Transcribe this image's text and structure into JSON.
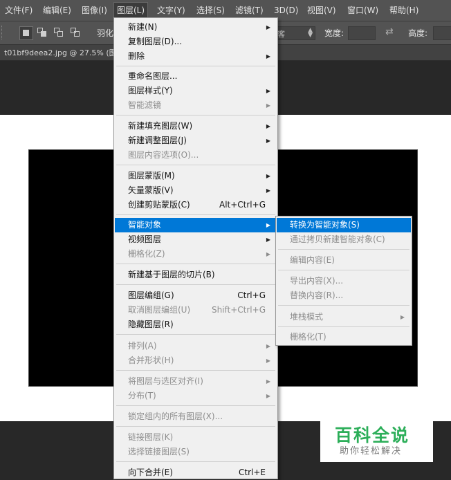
{
  "menubar": {
    "items": [
      {
        "label": "文件(F)"
      },
      {
        "label": "编辑(E)"
      },
      {
        "label": "图像(I)"
      },
      {
        "label": "图层(L)"
      },
      {
        "label": "文字(Y)"
      },
      {
        "label": "选择(S)"
      },
      {
        "label": "滤镜(T)"
      },
      {
        "label": "3D(D)"
      },
      {
        "label": "视图(V)"
      },
      {
        "label": "窗口(W)"
      },
      {
        "label": "帮助(H)"
      }
    ]
  },
  "options_bar": {
    "feather_label": "羽化",
    "style_partial": "客",
    "width_label": "宽度:",
    "height_label": "高度:"
  },
  "document_tab": {
    "title": "t01bf9deea2.jpg @ 27.5% (图"
  },
  "layer_menu": {
    "items": [
      {
        "label": "新建(N)",
        "submenu": true
      },
      {
        "label": "复制图层(D)..."
      },
      {
        "label": "删除",
        "submenu": true
      },
      {
        "label": "重命名图层..."
      },
      {
        "label": "图层样式(Y)",
        "submenu": true
      },
      {
        "label": "智能滤镜",
        "submenu": true,
        "disabled": true
      },
      {
        "label": "新建填充图层(W)",
        "submenu": true
      },
      {
        "label": "新建调整图层(J)",
        "submenu": true
      },
      {
        "label": "图层内容选项(O)...",
        "disabled": true
      },
      {
        "label": "图层蒙版(M)",
        "submenu": true
      },
      {
        "label": "矢量蒙版(V)",
        "submenu": true
      },
      {
        "label": "创建剪贴蒙版(C)",
        "shortcut": "Alt+Ctrl+G"
      },
      {
        "label": "智能对象",
        "submenu": true,
        "highlighted": true
      },
      {
        "label": "视频图层",
        "submenu": true
      },
      {
        "label": "栅格化(Z)",
        "submenu": true,
        "disabled": true
      },
      {
        "label": "新建基于图层的切片(B)"
      },
      {
        "label": "图层编组(G)",
        "shortcut": "Ctrl+G"
      },
      {
        "label": "取消图层编组(U)",
        "shortcut": "Shift+Ctrl+G",
        "disabled": true
      },
      {
        "label": "隐藏图层(R)"
      },
      {
        "label": "排列(A)",
        "submenu": true,
        "disabled": true
      },
      {
        "label": "合并形状(H)",
        "submenu": true,
        "disabled": true
      },
      {
        "label": "将图层与选区对齐(I)",
        "submenu": true,
        "disabled": true
      },
      {
        "label": "分布(T)",
        "submenu": true,
        "disabled": true
      },
      {
        "label": "锁定组内的所有图层(X)...",
        "disabled": true
      },
      {
        "label": "链接图层(K)",
        "disabled": true
      },
      {
        "label": "选择链接图层(S)",
        "disabled": true
      },
      {
        "label": "向下合并(E)",
        "shortcut": "Ctrl+E"
      }
    ]
  },
  "smart_object_submenu": {
    "items": [
      {
        "label": "转换为智能对象(S)",
        "highlighted": true
      },
      {
        "label": "通过拷贝新建智能对象(C)",
        "disabled": true
      },
      {
        "label": "编辑内容(E)",
        "disabled": true
      },
      {
        "label": "导出内容(X)...",
        "disabled": true
      },
      {
        "label": "替换内容(R)...",
        "disabled": true
      },
      {
        "label": "堆栈模式",
        "submenu": true,
        "disabled": true
      },
      {
        "label": "栅格化(T)",
        "disabled": true
      }
    ]
  },
  "watermark": {
    "title": "百科全说",
    "subtitle": "助你轻松解决"
  },
  "colors": {
    "menubar_bg": "#535353",
    "menu_bg": "#f0f0f0",
    "highlight": "#0078d7",
    "watermark_green": "#2cae59"
  }
}
